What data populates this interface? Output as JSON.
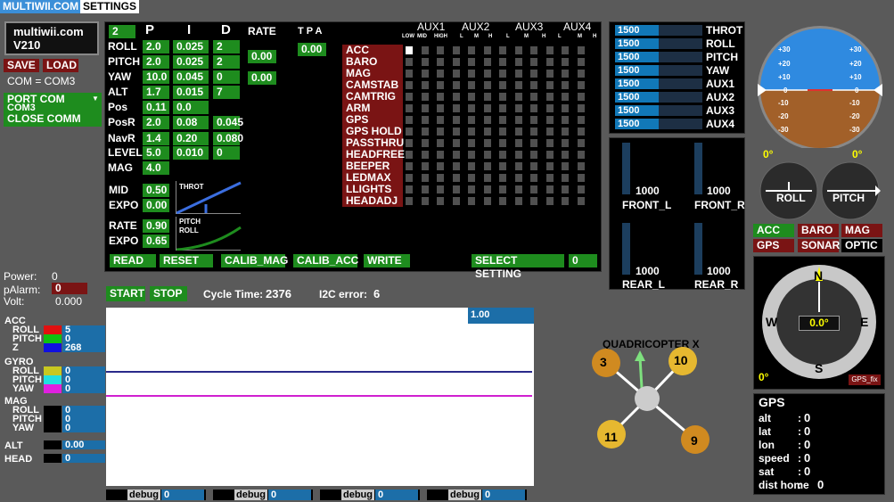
{
  "tabs": {
    "multiwii": "MULTIWII.COM",
    "settings": "SETTINGS"
  },
  "brand": {
    "name": "multiwii.com",
    "version": "V210"
  },
  "buttons": {
    "save": "SAVE",
    "load": "LOAD",
    "port_com": "PORT COM",
    "close_comm": "CLOSE COMM",
    "read": "READ",
    "reset": "RESET",
    "calib_mag": "CALIB_MAG",
    "calib_acc": "CALIB_ACC",
    "write": "WRITE",
    "select_setting": "SELECT SETTING",
    "start": "START",
    "stop": "STOP"
  },
  "com": {
    "current": "COM = COM3",
    "port_selected": "COM3"
  },
  "select_setting_value": "0",
  "pid": {
    "profile": "2",
    "headers": [
      "P",
      "I",
      "D"
    ],
    "rate_header": "RATE",
    "tpa_header": "T P A",
    "tpa": "0.00",
    "rows": [
      {
        "name": "ROLL",
        "p": "2.0",
        "i": "0.025",
        "d": "2"
      },
      {
        "name": "PITCH",
        "p": "2.0",
        "i": "0.025",
        "d": "2"
      },
      {
        "name": "YAW",
        "p": "10.0",
        "i": "0.045",
        "d": "0"
      },
      {
        "name": "ALT",
        "p": "1.7",
        "i": "0.015",
        "d": "7"
      },
      {
        "name": "Pos",
        "p": "0.11",
        "i": "0.0",
        "d": ""
      },
      {
        "name": "PosR",
        "p": "2.0",
        "i": "0.08",
        "d": "0.045"
      },
      {
        "name": "NavR",
        "p": "1.4",
        "i": "0.20",
        "d": "0.080"
      },
      {
        "name": "LEVEL",
        "p": "5.0",
        "i": "0.010",
        "d": "0"
      },
      {
        "name": "MAG",
        "p": "4.0",
        "i": "",
        "d": ""
      }
    ],
    "rate_rollpitch": "0.00",
    "rate_yaw": "0.00",
    "mid_label": "MID",
    "mid": "0.50",
    "expo_label": "EXPO",
    "expo": "0.00",
    "rate_label": "RATE",
    "rate": "0.90",
    "expo2_label": "EXPO",
    "expo2": "0.65",
    "throt_curve": "THROT",
    "pr_curve": [
      "PITCH",
      "ROLL"
    ]
  },
  "aux": {
    "headers": [
      "AUX1",
      "AUX2",
      "AUX3",
      "AUX4"
    ],
    "sub": [
      "LOW",
      "MID",
      "HIGH",
      "L",
      "M",
      "H",
      "L",
      "M",
      "H",
      "L",
      "M",
      "H"
    ],
    "boxes": [
      "ACC",
      "BARO",
      "MAG",
      "CAMSTAB",
      "CAMTRIG",
      "ARM",
      "GPS HOME",
      "GPS HOLD",
      "PASSTHRU",
      "HEADFREE",
      "BEEPER",
      "LEDMAX",
      "LLIGHTS",
      "HEADADJ"
    ]
  },
  "rc": [
    {
      "v": "1500",
      "n": "THROT"
    },
    {
      "v": "1500",
      "n": "ROLL"
    },
    {
      "v": "1500",
      "n": "PITCH"
    },
    {
      "v": "1500",
      "n": "YAW"
    },
    {
      "v": "1500",
      "n": "AUX1"
    },
    {
      "v": "1500",
      "n": "AUX2"
    },
    {
      "v": "1500",
      "n": "AUX3"
    },
    {
      "v": "1500",
      "n": "AUX4"
    }
  ],
  "rc_fill_fraction": 0.5,
  "sonar": {
    "front_l": {
      "v": "1000",
      "n": "FRONT_L"
    },
    "front_r": {
      "v": "1000",
      "n": "FRONT_R"
    },
    "rear_l": {
      "v": "1000",
      "n": "REAR_L"
    },
    "rear_r": {
      "v": "1000",
      "n": "REAR_R"
    }
  },
  "horizon": {
    "marks": [
      "+30",
      "+20",
      "+10",
      "0",
      "-10",
      "-20",
      "-30"
    ],
    "left_deg": "0°",
    "right_deg": "0°",
    "roll": "ROLL",
    "pitch": "PITCH"
  },
  "sensors": {
    "acc": "ACC",
    "baro": "BARO",
    "mag": "MAG",
    "gps": "GPS",
    "sonar": "SONAR",
    "optic": "OPTIC"
  },
  "compass": {
    "n": "N",
    "s": "S",
    "e": "E",
    "w": "W",
    "heading": "0.0°",
    "corner": "0°",
    "gps_fix": "GPS_fix"
  },
  "gps": {
    "title": "GPS",
    "rows": [
      {
        "k": "alt",
        "v": "0"
      },
      {
        "k": "lat",
        "v": "0"
      },
      {
        "k": "lon",
        "v": "0"
      },
      {
        "k": "speed",
        "v": "0"
      },
      {
        "k": "sat",
        "v": "0"
      },
      {
        "k": "dist home",
        "v": "0"
      }
    ]
  },
  "status": {
    "power_label": "Power:",
    "power": "0",
    "palarm_label": "pAlarm:",
    "palarm": "0",
    "volt_label": "Volt:",
    "volt": "0.000",
    "cycle_label": "Cycle Time:",
    "cycle": "2376",
    "i2c_label": "I2C error:",
    "i2c": "6"
  },
  "graph": {
    "scale": "1.00"
  },
  "sensor_readout": {
    "acc": "ACC",
    "gyro": "GYRO",
    "mag": "MAG",
    "roll": "ROLL",
    "pitch": "PITCH",
    "z": "Z",
    "yaw": "YAW",
    "acc_roll": "5",
    "acc_pitch": "0",
    "acc_z": "268",
    "gyro_roll": "0",
    "gyro_pitch": "0",
    "gyro_yaw": "0",
    "mag_roll": "0",
    "mag_pitch": "0",
    "mag_yaw": "0",
    "alt_label": "ALT",
    "alt": "0.00",
    "head_label": "HEAD",
    "head": "0"
  },
  "quad": {
    "title": "QUADRICOPTER X",
    "motors": [
      "3",
      "10",
      "11",
      "9"
    ]
  },
  "debug": [
    {
      "l": "debug",
      "v": "0"
    },
    {
      "l": "debug",
      "v": "0"
    },
    {
      "l": "debug",
      "v": "0"
    },
    {
      "l": "debug",
      "v": "0"
    }
  ],
  "colors": {
    "green": "#1e8c1e",
    "red": "#7a1414",
    "panel": "#000000",
    "bg": "#5a5a5a",
    "tab_blue": "#3b8fd8"
  }
}
